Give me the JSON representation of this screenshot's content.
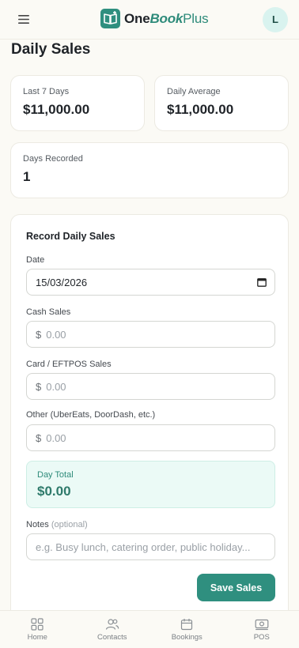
{
  "header": {
    "brand_one": "One",
    "brand_book": "Book",
    "brand_plus": "Plus",
    "avatar_initial": "L"
  },
  "page": {
    "title": "Daily Sales"
  },
  "stats": {
    "last7_label": "Last 7 Days",
    "last7_value": "$11,000.00",
    "avg_label": "Daily Average",
    "avg_value": "$11,000.00",
    "days_label": "Days Recorded",
    "days_value": "1"
  },
  "form": {
    "title": "Record Daily Sales",
    "date_label": "Date",
    "date_value": "15/03/2026",
    "currency_symbol": "$",
    "cash_label": "Cash Sales",
    "cash_placeholder": "0.00",
    "card_label": "Card / EFTPOS Sales",
    "card_placeholder": "0.00",
    "other_label": "Other (UberEats, DoorDash, etc.)",
    "other_placeholder": "0.00",
    "total_label": "Day Total",
    "total_value": "$0.00",
    "notes_label": "Notes",
    "notes_optional": "(optional)",
    "notes_placeholder": "e.g. Busy lunch, catering order, public holiday...",
    "save_label": "Save Sales"
  },
  "nav": {
    "items": [
      {
        "label": "Home",
        "icon": "grid-icon"
      },
      {
        "label": "Contacts",
        "icon": "users-icon"
      },
      {
        "label": "Bookings",
        "icon": "calendar-icon"
      },
      {
        "label": "POS",
        "icon": "cash-icon"
      }
    ]
  },
  "colors": {
    "accent": "#2f8f7f",
    "background": "#fbfaf5",
    "avatar_bg": "#d9f3ef",
    "total_bg": "#ebfaf6"
  }
}
